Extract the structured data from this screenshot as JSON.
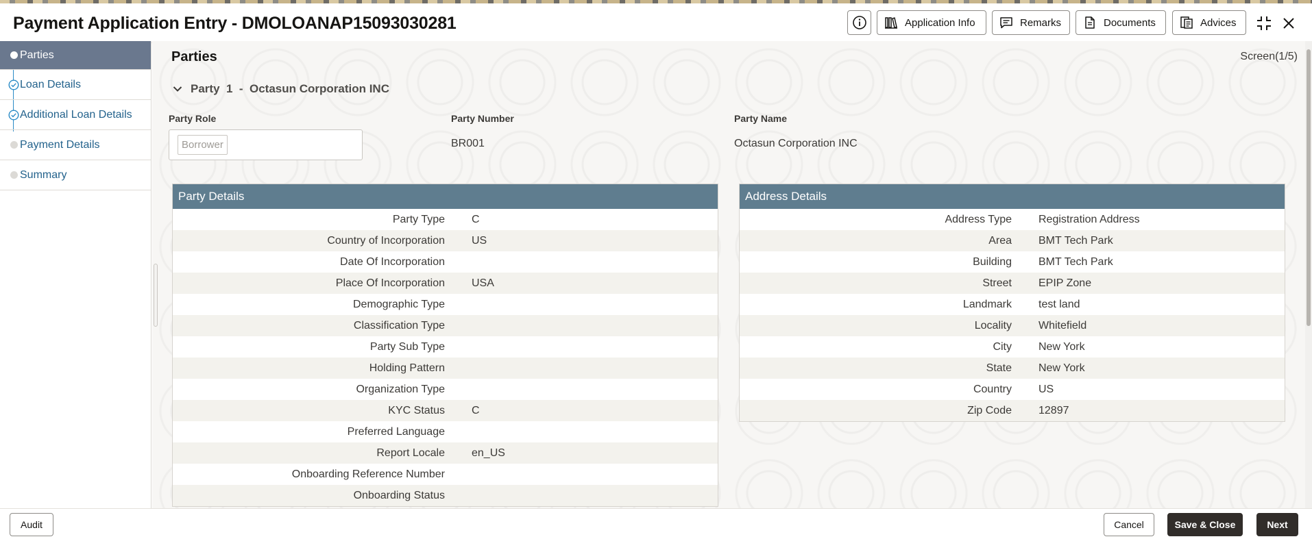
{
  "header": {
    "title": "Payment Application Entry - DMOLOANAP15093030281",
    "buttons": {
      "application_info": "Application Info",
      "remarks": "Remarks",
      "documents": "Documents",
      "advices": "Advices"
    },
    "icons": [
      "info-icon",
      "library-icon",
      "comment-icon",
      "document-icon",
      "advices-icon",
      "collapse-icon",
      "close-icon"
    ]
  },
  "sidebar": {
    "items": [
      {
        "label": "Parties",
        "state": "active"
      },
      {
        "label": "Loan Details",
        "state": "completed"
      },
      {
        "label": "Additional Loan Details",
        "state": "completed"
      },
      {
        "label": "Payment Details",
        "state": "pending"
      },
      {
        "label": "Summary",
        "state": "pending"
      }
    ]
  },
  "content": {
    "title": "Parties",
    "screen_indicator": "Screen(1/5)",
    "party_header": "Party  1  -  Octasun Corporation INC",
    "fields": {
      "party_role_label": "Party Role",
      "party_role_value": "Borrower",
      "party_number_label": "Party Number",
      "party_number_value": "BR001",
      "party_name_label": "Party Name",
      "party_name_value": "Octasun Corporation INC"
    },
    "party_details": {
      "title": "Party Details",
      "rows": [
        {
          "label": "Party Type",
          "value": "C"
        },
        {
          "label": "Country of Incorporation",
          "value": "US"
        },
        {
          "label": "Date Of Incorporation",
          "value": ""
        },
        {
          "label": "Place Of Incorporation",
          "value": "USA"
        },
        {
          "label": "Demographic Type",
          "value": ""
        },
        {
          "label": "Classification Type",
          "value": ""
        },
        {
          "label": "Party Sub Type",
          "value": ""
        },
        {
          "label": "Holding Pattern",
          "value": ""
        },
        {
          "label": "Organization Type",
          "value": ""
        },
        {
          "label": "KYC Status",
          "value": "C"
        },
        {
          "label": "Preferred Language",
          "value": ""
        },
        {
          "label": "Report Locale",
          "value": "en_US"
        },
        {
          "label": "Onboarding Reference Number",
          "value": ""
        },
        {
          "label": "Onboarding Status",
          "value": ""
        }
      ]
    },
    "address_details": {
      "title": "Address Details",
      "rows": [
        {
          "label": "Address Type",
          "value": "Registration Address"
        },
        {
          "label": "Area",
          "value": "BMT Tech Park"
        },
        {
          "label": "Building",
          "value": "BMT Tech Park"
        },
        {
          "label": "Street",
          "value": "EPIP Zone"
        },
        {
          "label": "Landmark",
          "value": "test land"
        },
        {
          "label": "Locality",
          "value": "Whitefield"
        },
        {
          "label": "City",
          "value": "New York"
        },
        {
          "label": "State",
          "value": "New York"
        },
        {
          "label": "Country",
          "value": "US"
        },
        {
          "label": "Zip Code",
          "value": "12897"
        }
      ]
    }
  },
  "footer": {
    "audit": "Audit",
    "cancel": "Cancel",
    "save_close": "Save & Close",
    "next": "Next"
  },
  "colors": {
    "sidebar_active_bg": "#6a788e",
    "panel_header_bg": "#5f7d8f",
    "link_text": "#23628c",
    "step_accent": "#2b8bc6",
    "primary_button_bg": "#312d2a"
  }
}
